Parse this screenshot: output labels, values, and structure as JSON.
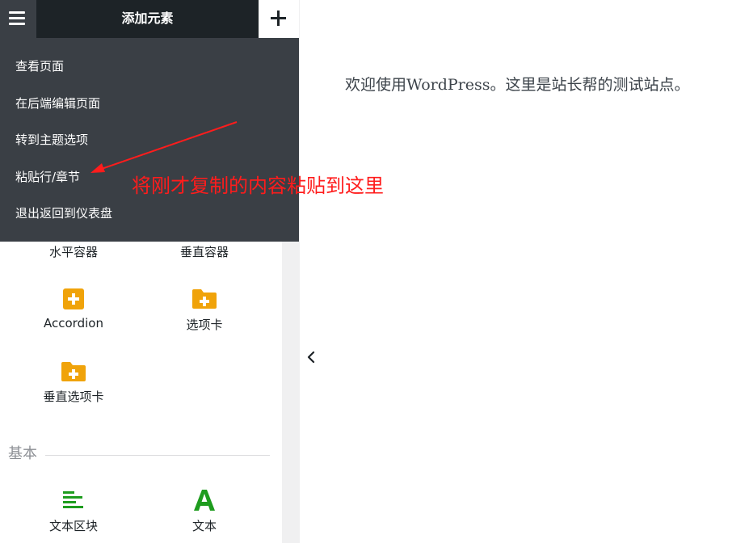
{
  "header": {
    "title": "添加元素"
  },
  "menu": {
    "items": [
      {
        "label": "查看页面"
      },
      {
        "label": "在后端编辑页面"
      },
      {
        "label": "转到主题选项"
      },
      {
        "label": "粘贴行/章节"
      },
      {
        "label": "退出返回到仪表盘"
      }
    ]
  },
  "elements": {
    "layout": [
      {
        "label": "水平容器"
      },
      {
        "label": "垂直容器"
      },
      {
        "label": "Accordion",
        "icon": "plus-box-icon"
      },
      {
        "label": "选项卡",
        "icon": "folder-plus-icon"
      },
      {
        "label": "垂直选项卡",
        "icon": "folder-plus-icon"
      }
    ],
    "basic_section": "基本",
    "basic": [
      {
        "label": "文本区块",
        "icon": "text-lines-icon"
      },
      {
        "label": "文本",
        "icon": "letter-a-icon"
      }
    ]
  },
  "preview": {
    "welcome": "欢迎使用WordPress。这里是站长帮的测试站点。"
  },
  "annotation": {
    "text": "将刚才复制的内容粘贴到这里",
    "color": "#ff1c1c"
  },
  "colors": {
    "dark": "#1d2327",
    "menu_bg": "#3a3f45",
    "accent_orange": "#f0a30a",
    "accent_green": "#1e9c1e"
  }
}
